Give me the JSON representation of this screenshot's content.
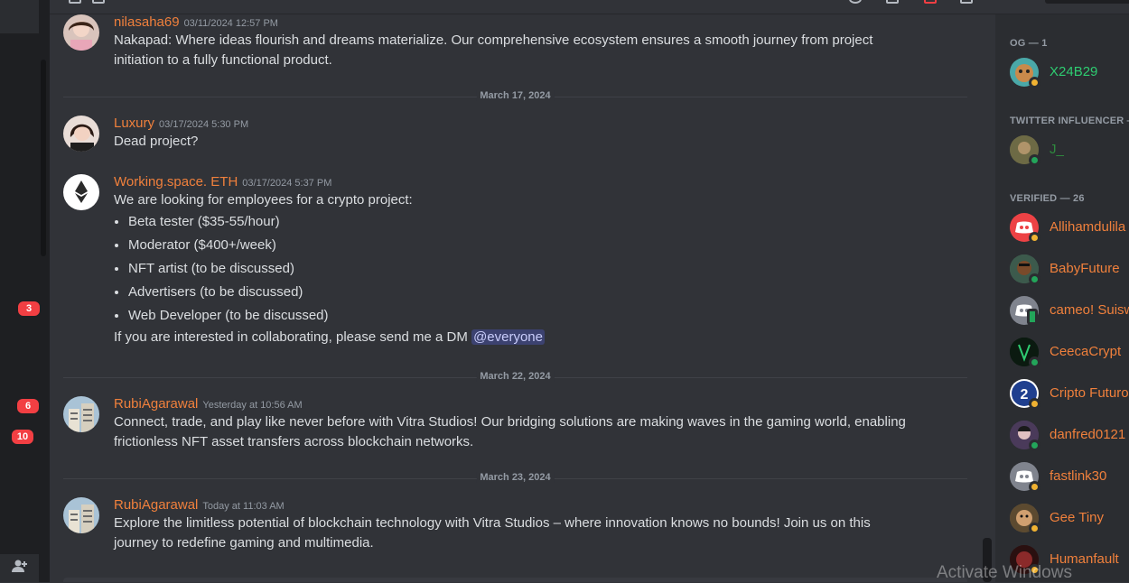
{
  "rail": {
    "badges": [
      "3",
      "6",
      "10"
    ]
  },
  "messages": [
    {
      "author": "nilasaha69",
      "timestamp": "03/11/2024 12:57 PM",
      "lines": [
        "Nakapad: Where ideas flourish and dreams materialize. Our comprehensive ecosystem ensures a smooth journey from project",
        "initiation to a fully functional product."
      ]
    },
    {
      "author": "Luxury",
      "timestamp": "03/17/2024 5:30 PM",
      "lines": [
        "Dead project?"
      ]
    },
    {
      "author": "Working.space. ETH",
      "timestamp": "03/17/2024 5:37 PM",
      "intro": "We are looking for employees for a crypto project:",
      "bullets": [
        "Beta tester ($35-55/hour)",
        "Moderator ($400+/week)",
        "NFT artist (to be discussed)",
        "Advertisers (to be discussed)",
        "Web Developer (to be discussed)"
      ],
      "outro": "If you are interested in collaborating, please send me a DM ",
      "mention": "@everyone"
    },
    {
      "author": "RubiAgarawal",
      "timestamp": "Yesterday at 10:56 AM",
      "lines": [
        "Connect, trade, and play like never before with Vitra Studios! Our bridging solutions are making waves in the gaming world, enabling",
        "frictionless NFT asset transfers across blockchain networks."
      ]
    },
    {
      "author": "RubiAgarawal",
      "timestamp": "Today at 11:03 AM",
      "lines": [
        "Explore the limitless potential of blockchain technology with Vitra Studios – where innovation knows no bounds! Join us on this",
        "journey to redefine gaming and multimedia."
      ]
    }
  ],
  "dividers": [
    "March 17, 2024",
    "March 22, 2024",
    "March 23, 2024"
  ],
  "members": {
    "groups": [
      {
        "header": "OG — 1",
        "members": [
          {
            "name": "X24B29",
            "status": "idle"
          }
        ]
      },
      {
        "header": "TWITTER INFLUENCER —",
        "members": [
          {
            "name": "J_",
            "status": "online"
          }
        ]
      },
      {
        "header": "VERIFIED — 26",
        "members": [
          {
            "name": "Allihamdulila",
            "status": "idle"
          },
          {
            "name": "BabyFuture",
            "status": "online"
          },
          {
            "name": "cameo! Suisw",
            "status": "mobile"
          },
          {
            "name": "CeecaCrypt",
            "status": "online"
          },
          {
            "name": "Cripto Futuro",
            "status": "idle"
          },
          {
            "name": "danfred0121",
            "status": "online"
          },
          {
            "name": "fastlink30",
            "status": "idle"
          },
          {
            "name": "Gee Tiny",
            "status": "idle"
          },
          {
            "name": "Humanfault",
            "status": "idle"
          }
        ]
      }
    ]
  },
  "overlay": {
    "activate_windows": "Activate Windows"
  },
  "colors": {
    "author": "#f0803c",
    "og_member": "#2ecc71",
    "mention_bg": "#3c4270",
    "badge": "#f23f43"
  }
}
